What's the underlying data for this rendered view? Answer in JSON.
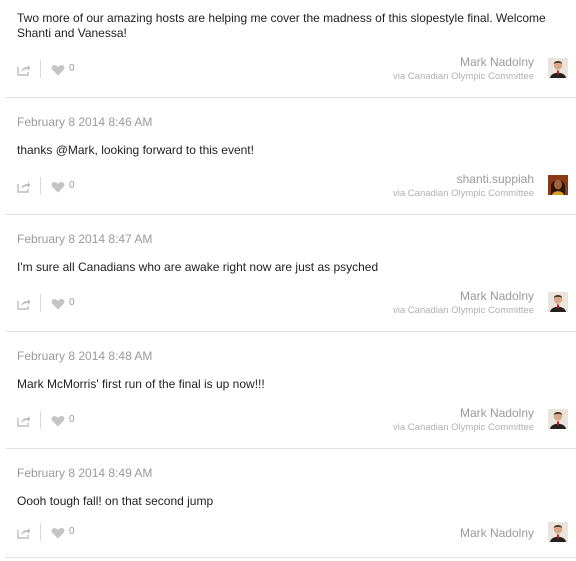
{
  "posts": [
    {
      "timestamp": "",
      "text": "Two more of our amazing hosts are helping me cover the madness of this slopestyle final. Welcome Shanti and Vanessa!",
      "likes": "0",
      "author": "Mark Nadolny",
      "via": "via Canadian Olympic Committee",
      "avatar": "mark"
    },
    {
      "timestamp": "February 8 2014 8:46 AM",
      "text": "thanks @Mark, looking forward to this event!",
      "likes": "0",
      "author": "shanti.suppiah",
      "via": "via Canadian Olympic Committee",
      "avatar": "shanti"
    },
    {
      "timestamp": "February 8 2014 8:47 AM",
      "text": "I'm sure all Canadians who are awake right now are just as psyched",
      "likes": "0",
      "author": "Mark Nadolny",
      "via": "via Canadian Olympic Committee",
      "avatar": "mark"
    },
    {
      "timestamp": "February 8 2014 8:48 AM",
      "text": "Mark McMorris' first run of the final is up now!!!",
      "likes": "0",
      "author": "Mark Nadolny",
      "via": "via Canadian Olympic Committee",
      "avatar": "mark"
    },
    {
      "timestamp": "February 8 2014 8:49 AM",
      "text": "Oooh tough fall! on that second jump",
      "likes": "0",
      "author": "Mark Nadolny",
      "via": "",
      "avatar": "mark"
    }
  ],
  "icons": {
    "share": "share-icon",
    "like": "heart-icon"
  },
  "colors": {
    "text": "#222222",
    "meta": "#9a9a9a",
    "divider": "#e3e3e3"
  }
}
